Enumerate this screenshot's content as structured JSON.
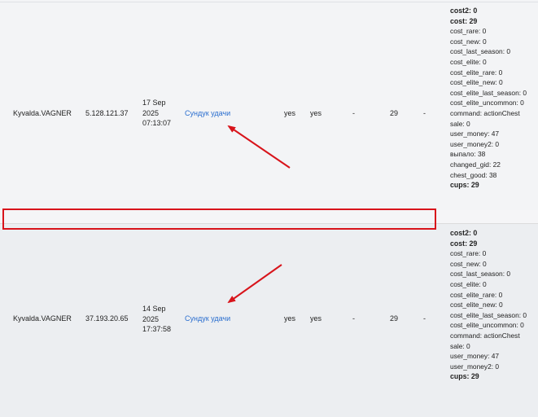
{
  "rows": [
    {
      "user": "Kyvalda.VAGNER",
      "ip": "5.128.121.37",
      "date_day": "17 Sep",
      "date_year": "2025",
      "date_time": "07:13:07",
      "action_link": "Сундук удачи",
      "col_yes1": "yes",
      "col_yes2": "yes",
      "col_dash1": "-",
      "col_num": "29",
      "col_dash2": "-",
      "details": {
        "cost2": "cost2: 0",
        "cost": "cost: 29",
        "cost_rare": "cost_rare: 0",
        "cost_new": "cost_new: 0",
        "cost_last_season": "cost_last_season: 0",
        "cost_elite": "cost_elite: 0",
        "cost_elite_rare": "cost_elite_rare: 0",
        "cost_elite_new": "cost_elite_new: 0",
        "cost_elite_last_season": "cost_elite_last_season: 0",
        "cost_elite_uncommon": "cost_elite_uncommon: 0",
        "command": "command: actionChest",
        "sale": "sale: 0",
        "user_money": "user_money: 47",
        "user_money2": "user_money2: 0",
        "vypalo": "выпало: 38",
        "changed_gid": "changed_gid: 22",
        "chest_good": "chest_good: 38",
        "cups": "cups: 29"
      }
    },
    {
      "user": "Kyvalda.VAGNER",
      "ip": "37.193.20.65",
      "date_day": "14 Sep",
      "date_year": "2025",
      "date_time": "17:37:58",
      "action_link": "Сундук удачи",
      "col_yes1": "yes",
      "col_yes2": "yes",
      "col_dash1": "-",
      "col_num": "29",
      "col_dash2": "-",
      "details": {
        "cost2": "cost2: 0",
        "cost": "cost: 29",
        "cost_rare": "cost_rare: 0",
        "cost_new": "cost_new: 0",
        "cost_last_season": "cost_last_season: 0",
        "cost_elite": "cost_elite: 0",
        "cost_elite_rare": "cost_elite_rare: 0",
        "cost_elite_new": "cost_elite_new: 0",
        "cost_elite_last_season": "cost_elite_last_season: 0",
        "cost_elite_uncommon": "cost_elite_uncommon: 0",
        "command": "command: actionChest",
        "sale": "sale: 0",
        "user_money": "user_money: 47",
        "user_money2": "user_money2: 0",
        "cups": "cups: 29"
      }
    }
  ],
  "annotation_color": "#d8141b"
}
